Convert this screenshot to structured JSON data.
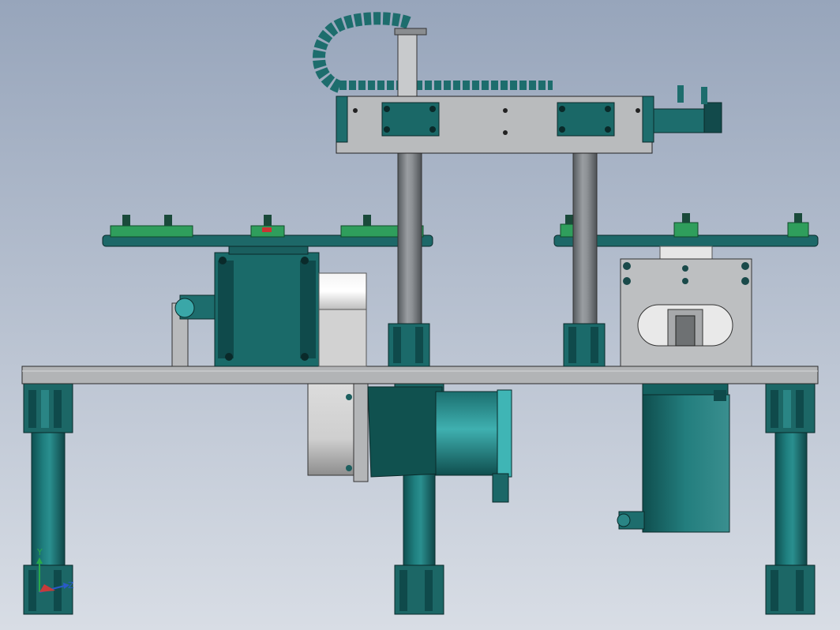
{
  "viewport": {
    "background_top": "#9aa7bd",
    "background_bottom": "#d6dbe4",
    "type": "3D CAD assembly view"
  },
  "colors": {
    "teal": "#1f6f6e",
    "teal_dark": "#134a4b",
    "teal_light": "#3aa7a8",
    "steel": "#a9abad",
    "steel_light": "#c6c8ca",
    "steel_dark": "#6d7073",
    "green_fixture": "#2f9e5c",
    "outline": "#1a1a1a",
    "motor_white": "#e8e8e8"
  },
  "triad": {
    "x_label": "",
    "y_label": "Y",
    "z_label": "Z",
    "icons": [
      "y-axis-arrow-icon",
      "z-axis-arrow-icon",
      "x-axis-arrow-icon"
    ]
  }
}
